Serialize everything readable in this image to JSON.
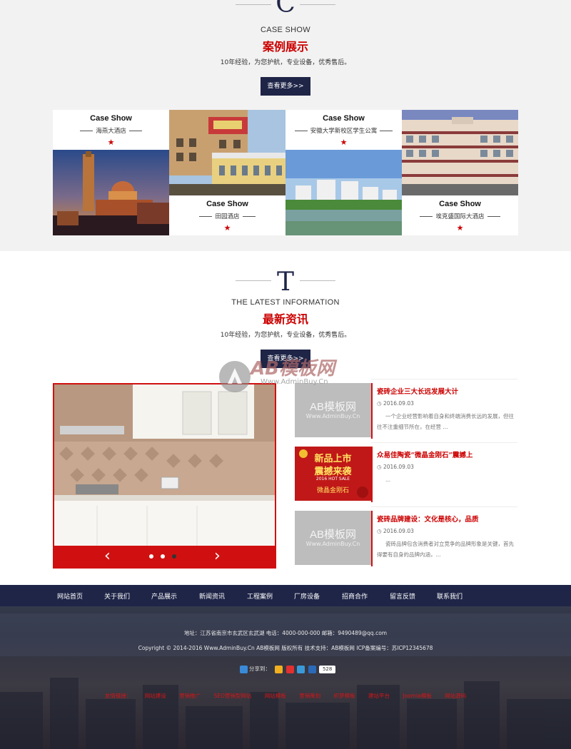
{
  "case_section": {
    "letter": "C",
    "title_en": "CASE SHOW",
    "title_cn": "案例展示",
    "desc": "10年经验，为您护航，专业设备，优秀售后。",
    "more_label": "查看更多>>",
    "cases": [
      {
        "title": "Case Show",
        "name": "海燕大酒店"
      },
      {
        "title": "Case Show",
        "name": "田园酒店"
      },
      {
        "title": "Case Show",
        "name": "安徽大学新校区学生公寓"
      },
      {
        "title": "Case Show",
        "name": "埃克盛国际大酒店"
      }
    ],
    "star": "★"
  },
  "news_section": {
    "letter": "T",
    "title_en": "THE LATEST INFORMATION",
    "title_cn": "最新资讯",
    "desc": "10年经验，为您护航，专业设备，优秀售后。",
    "more_label": "查看更多>>",
    "slider": {
      "prev": "‹",
      "next": "›",
      "dots": 3,
      "active_dot": 2
    },
    "items": [
      {
        "title": "瓷砖企业三大长远发展大计",
        "date": "2016.09.03",
        "summary": "一个企业经营影响着自身和终端消费长远的发展，但往往不注重细节所在，在经营 ...",
        "thumb_a": "AB模板网",
        "thumb_b": "Www.AdminBuy.Cn"
      },
      {
        "title": "众易佳陶瓷“微晶金刚石”震撼上",
        "date": "2016.09.03",
        "summary": "...",
        "promo_a": "新品上市",
        "promo_b": "震撼来袭",
        "promo_c": "2016 HOT SALE",
        "promo_d": "微晶金刚石"
      },
      {
        "title": "瓷砖品牌建设：文化是核心，品质",
        "date": "2016.09.03",
        "summary": "瓷砖品牌包含消费者对立竞争的品牌形象是关键，首先得要有自身的品牌内涵，...",
        "thumb_a": "AB模板网",
        "thumb_b": "Www.AdminBuy.Cn"
      }
    ]
  },
  "watermark": {
    "logo": "AB模板网",
    "url": "Www.AdminBuy.Cn"
  },
  "footer": {
    "nav": [
      "网站首页",
      "关于我们",
      "产品展示",
      "新闻资讯",
      "工程案例",
      "厂房设备",
      "招商合作",
      "留言反馈",
      "联系我们"
    ],
    "address_line": "地址：江苏省南京市玄武区玄武湖    电话：4000-000-000    邮箱：9490489@qq.com",
    "copyright_line": "Copyright © 2014-2016 Www.AdminBuy.Cn AB模板网 版权所有    技术支持：AB模板网    ICP备案编号：苏ICP12345678",
    "share_label": "分享到：",
    "share_count": "528",
    "links": [
      "友情链接：",
      "网站建设",
      "营销推广",
      "SEO营销型网站",
      "网站模板",
      "营销策划",
      "织梦模板",
      "建站平台",
      "Joomla模板",
      "网站源码"
    ],
    "colors": {
      "nav_bg": "#1f2547",
      "accent_red": "#cc0000"
    }
  }
}
